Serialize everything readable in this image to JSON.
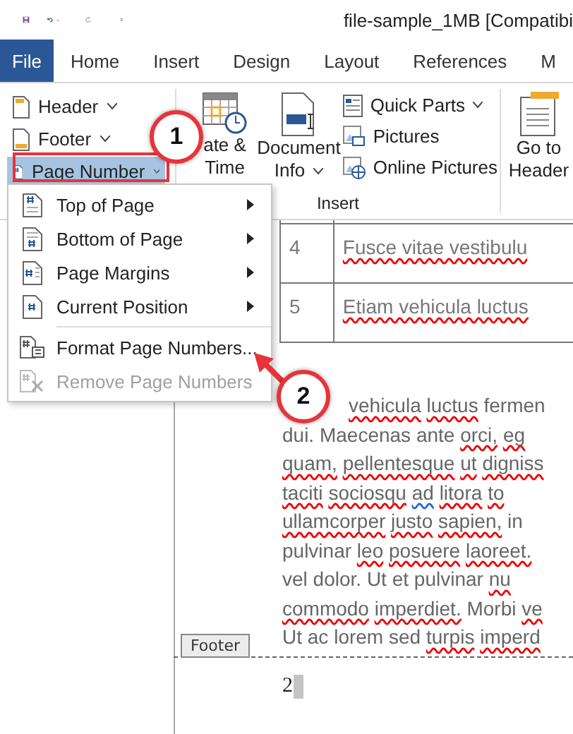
{
  "window": {
    "title": "file-sample_1MB [Compatibi"
  },
  "tabs": [
    {
      "label": "File",
      "kind": "file",
      "selected": false
    },
    {
      "label": "Home",
      "kind": "tab",
      "selected": false
    },
    {
      "label": "Insert",
      "kind": "tab",
      "selected": false
    },
    {
      "label": "Design",
      "kind": "tab",
      "selected": false
    },
    {
      "label": "Layout",
      "kind": "tab",
      "selected": false
    },
    {
      "label": "References",
      "kind": "tab",
      "selected": false
    },
    {
      "label": "M",
      "kind": "tab",
      "selected": false
    }
  ],
  "ribbon": {
    "header_footer_buttons": [
      {
        "label": "Header",
        "kind": "header",
        "pressed": false
      },
      {
        "label": "Footer",
        "kind": "footer",
        "pressed": false
      },
      {
        "label": "Page Number",
        "kind": "page-number",
        "pressed": true
      }
    ],
    "insert_group": {
      "label": "Insert",
      "large_buttons": [
        {
          "lines": [
            "ate &",
            "Time"
          ],
          "kind": "date",
          "dropdown": false
        },
        {
          "lines": [
            "Document",
            "Info"
          ],
          "kind": "doc",
          "dropdown": true
        }
      ],
      "small_buttons": [
        {
          "label": "Quick Parts",
          "kind": "parts",
          "dropdown": true
        },
        {
          "label": "Pictures",
          "kind": "pictures",
          "dropdown": false
        },
        {
          "label": "Online Pictures",
          "kind": "online",
          "dropdown": false
        }
      ]
    },
    "go_to_header": {
      "lines": [
        "Go to",
        "Header"
      ]
    }
  },
  "menu": {
    "items": [
      {
        "label": "Top of Page",
        "kind": "top",
        "submenu": true,
        "disabled": false
      },
      {
        "label": "Bottom of Page",
        "kind": "bottom",
        "submenu": true,
        "disabled": false
      },
      {
        "label": "Page Margins",
        "kind": "margins",
        "submenu": true,
        "disabled": false
      },
      {
        "label": "Current Position",
        "kind": "current",
        "submenu": true,
        "disabled": false
      },
      {
        "label": "Format Page Numbers...",
        "kind": "format",
        "submenu": false,
        "disabled": false
      },
      {
        "label": "Remove Page Numbers",
        "kind": "remove",
        "submenu": false,
        "disabled": true
      }
    ]
  },
  "table": {
    "rows": [
      {
        "number": "4",
        "text": "Fusce vitae vestibulu",
        "misspelled": true
      },
      {
        "number": "5",
        "text": "Etiam vehicula luctus",
        "misspelled": true
      }
    ]
  },
  "document": {
    "lines": [
      [
        {
          "text": "vehicula",
          "misspelled": true,
          "grammar_issue": false
        },
        {
          "text": "luctus",
          "misspelled": true,
          "grammar_issue": false
        },
        {
          "text": "fermen",
          "misspelled": false,
          "grammar_issue": false
        }
      ],
      [
        {
          "text": "dui.",
          "misspelled": false,
          "grammar_issue": false
        },
        {
          "text": "Maecenas",
          "misspelled": false,
          "grammar_issue": false
        },
        {
          "text": "ante",
          "misspelled": false,
          "grammar_issue": false
        },
        {
          "text": "orci,",
          "misspelled": true,
          "grammar_issue": false
        },
        {
          "text": "eg",
          "misspelled": true,
          "grammar_issue": false
        }
      ],
      [
        {
          "text": "quam,",
          "misspelled": true,
          "grammar_issue": false
        },
        {
          "text": "pellentesque",
          "misspelled": true,
          "grammar_issue": false
        },
        {
          "text": "ut",
          "misspelled": true,
          "grammar_issue": false
        },
        {
          "text": "digniss",
          "misspelled": true,
          "grammar_issue": false
        }
      ],
      [
        {
          "text": "taciti",
          "misspelled": true,
          "grammar_issue": false
        },
        {
          "text": "sociosqu",
          "misspelled": true,
          "grammar_issue": false
        },
        {
          "text": "ad",
          "misspelled": false,
          "grammar_issue": true
        },
        {
          "text": "litora",
          "misspelled": true,
          "grammar_issue": false
        },
        {
          "text": "to",
          "misspelled": true,
          "grammar_issue": false
        }
      ],
      [
        {
          "text": "ullamcorper",
          "misspelled": true,
          "grammar_issue": false
        },
        {
          "text": "justo",
          "misspelled": true,
          "grammar_issue": false
        },
        {
          "text": "sapien,",
          "misspelled": true,
          "grammar_issue": false
        },
        {
          "text": "in",
          "misspelled": false,
          "grammar_issue": false
        }
      ],
      [
        {
          "text": "pulvinar",
          "misspelled": false,
          "grammar_issue": false
        },
        {
          "text": "leo",
          "misspelled": true,
          "grammar_issue": false
        },
        {
          "text": "posuere",
          "misspelled": true,
          "grammar_issue": false
        },
        {
          "text": "laoreet.",
          "misspelled": true,
          "grammar_issue": false
        }
      ],
      [
        {
          "text": "vel",
          "misspelled": false,
          "grammar_issue": false
        },
        {
          "text": "dolor.",
          "misspelled": false,
          "grammar_issue": false
        },
        {
          "text": "Ut",
          "misspelled": false,
          "grammar_issue": false
        },
        {
          "text": "et",
          "misspelled": false,
          "grammar_issue": false
        },
        {
          "text": "pulvinar",
          "misspelled": false,
          "grammar_issue": false
        },
        {
          "text": "nu",
          "misspelled": true,
          "grammar_issue": false
        }
      ],
      [
        {
          "text": "commodo",
          "misspelled": true,
          "grammar_issue": false
        },
        {
          "text": "imperdiet.",
          "misspelled": true,
          "grammar_issue": false
        },
        {
          "text": "Morbi",
          "misspelled": false,
          "grammar_issue": false
        },
        {
          "text": "ve",
          "misspelled": true,
          "grammar_issue": false
        }
      ],
      [
        {
          "text": "Ut",
          "misspelled": false,
          "grammar_issue": false
        },
        {
          "text": "ac",
          "misspelled": false,
          "grammar_issue": false
        },
        {
          "text": "lorem",
          "misspelled": false,
          "grammar_issue": false
        },
        {
          "text": "sed",
          "misspelled": false,
          "grammar_issue": false
        },
        {
          "text": "turpis",
          "misspelled": true,
          "grammar_issue": false
        },
        {
          "text": "imperd",
          "misspelled": true,
          "grammar_issue": false
        }
      ]
    ],
    "footer_tag": "Footer",
    "page_number": "2",
    "cursor": true
  },
  "annotations": [
    {
      "label": "1"
    },
    {
      "label": "2"
    }
  ]
}
